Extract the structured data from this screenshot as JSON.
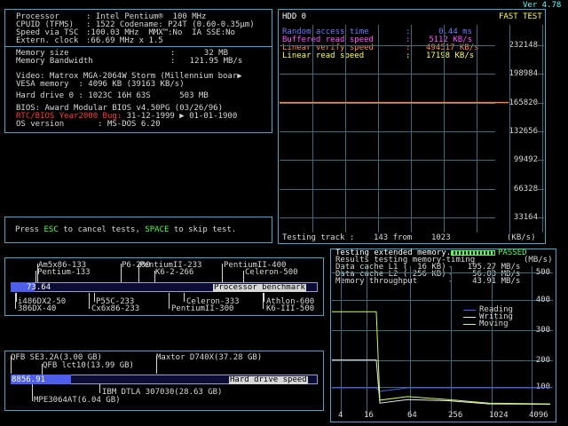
{
  "version": "Ver 4.78",
  "sysinfo": {
    "rows": [
      {
        "label": "Processor",
        "value": ": Intel Pentium®  100 MHz"
      },
      {
        "label": "CPUID (TFMS)",
        "value": ": 1522 Codename: P24T (0.60-0.35µm)"
      },
      {
        "label": "Speed via TSC",
        "value": ":100.03 MHz  MMX™:No  IA SSE:No"
      },
      {
        "label": "Extern. clock",
        "value": ":66.69 MHz x 1.5"
      }
    ],
    "mem_rows": [
      {
        "label": "Memory size",
        "value": ":      32 MB"
      },
      {
        "label": "Memory Bandwidth",
        "value": ":   121.95 MB/s"
      }
    ],
    "video_line": "Video: Matrox MGA-2064W Storm (Millennium boar▶",
    "vesa_line": "VESA memory  : 4096 KB (39163 KB/s)",
    "hdd_line": "Hard drive 0 : 1023C 16H 63S      503 MB",
    "bios_line": "BIOS: Award Modular BIOS v4.50PG (03/26/96)",
    "y2k_label": "RTC/BIOS Year2000 Bug:",
    "y2k_value": " 31-12-1999 ▶ 01-01-1900",
    "os_line": "OS version       : MS-DOS 6.20"
  },
  "hint": {
    "prefix": "Press ",
    "key1": "ESC",
    "mid": " to cancel tests, ",
    "key2": "SPACE",
    "suffix": " to skip test."
  },
  "hdd_panel": {
    "title": "HDD 0",
    "mode": "FAST TEST",
    "stats": [
      {
        "label": "Random access time",
        "sep": ":",
        "value": "0.44 ms",
        "color": "#6f78ff"
      },
      {
        "label": "Buffered read speed",
        "sep": ":",
        "value": "5112 KB/s",
        "color": "#ff55ff"
      },
      {
        "label": "Linear verify speed",
        "sep": ":",
        "value": "494517 KB/s",
        "color": "#ff8a3b"
      },
      {
        "label": "Linear read speed",
        "sep": ":",
        "value": "17198 KB/s",
        "color": "#ffff55"
      }
    ],
    "y_ticks": [
      "232148",
      "198984",
      "165820",
      "132656",
      "99492",
      "66328",
      "33164"
    ],
    "status": "Testing track :    143 from    1023",
    "unit": "(KB/s)"
  },
  "cpu_bench": {
    "labels_top": [
      {
        "text": "Am5x86-133",
        "row": 0
      },
      {
        "text": "P6-200",
        "row": 0
      },
      {
        "text": "PentiumII-233",
        "row": 0
      },
      {
        "text": "PentiumII-400",
        "row": 0
      },
      {
        "text": "Pentium-133",
        "row": 1
      },
      {
        "text": "K6-2-266",
        "row": 1
      },
      {
        "text": "Celeron-500",
        "row": 1
      }
    ],
    "labels_bottom": [
      {
        "text": "i486DX2-50"
      },
      {
        "text": "P55C-233"
      },
      {
        "text": "Celeron-333"
      },
      {
        "text": "Athlon-600"
      },
      {
        "text": "386DX-40"
      },
      {
        "text": "Cx6x86-233"
      },
      {
        "text": "PentiumII-300"
      },
      {
        "text": "K6-III-500"
      }
    ],
    "value": "73.64",
    "bar_fraction": 0.05,
    "title": "Processor benchmark"
  },
  "hdd_bench": {
    "labels_top": [
      {
        "text": "QFB SE3.2A(3.00 GB)"
      },
      {
        "text": "Maxtor D740X(37.28 GB)"
      },
      {
        "text": "QFB lct10(13.99 GB)"
      }
    ],
    "labels_bottom": [
      {
        "text": "IBM DTLA 307030(28.63 GB)"
      },
      {
        "text": "MPE3064AT(6.04 GB)"
      }
    ],
    "value": "8856.91",
    "bar_fraction": 0.18,
    "title": "Hard drive speed"
  },
  "mem_panel": {
    "status_label": "Testing extended memory...",
    "status_result": "PASSED",
    "results_title": "Results testing memory-timing",
    "unit": "(MB/s)",
    "rows": [
      {
        "label": "Data cache L1 (  16 KB)",
        "value": "-   195.27 MB/s"
      },
      {
        "label": "Data cache L2 ( 256 KB)",
        "value": "-    56.03 MB/s"
      },
      {
        "label": "Memory throughput",
        "value": "-    43.91 MB/s"
      }
    ],
    "legend": [
      {
        "name": "Reading",
        "color": "#4c5eea"
      },
      {
        "name": "Writing",
        "color": "#e8e8e8"
      },
      {
        "name": "Moving",
        "color": "#ccff66"
      }
    ],
    "y_ticks": [
      "500",
      "400",
      "300",
      "200",
      "100"
    ],
    "x_ticks": [
      "4",
      "16",
      "64",
      "256",
      "1024",
      "4096"
    ]
  },
  "chart_data": [
    {
      "type": "line",
      "title": "HDD 0",
      "xlabel": "",
      "ylabel": "(KB/s)",
      "ylim": [
        0,
        250000
      ],
      "x": [
        0,
        143
      ],
      "series": [
        {
          "values": [
            165820,
            165820
          ]
        }
      ],
      "grid": true
    },
    {
      "type": "line",
      "title": "Results testing memory-timing",
      "xlabel": "",
      "ylabel": "(MB/s)",
      "ylim": [
        0,
        550
      ],
      "x": [
        4,
        16,
        64,
        256,
        1024,
        4096
      ],
      "series": [
        {
          "name": "Reading",
          "values": [
            100,
            100,
            100,
            100,
            100,
            100
          ]
        },
        {
          "name": "Writing",
          "values": [
            195,
            195,
            60,
            56,
            45,
            44
          ]
        },
        {
          "name": "Moving",
          "values": [
            360,
            360,
            70,
            60,
            48,
            45
          ]
        }
      ],
      "grid": true
    }
  ]
}
